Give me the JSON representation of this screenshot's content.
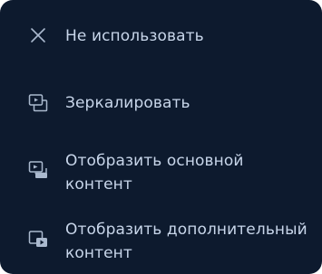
{
  "menu": {
    "items": [
      {
        "label": "Не использовать",
        "icon": "close-icon"
      },
      {
        "label": "Зеркалировать",
        "icon": "mirror-screen-icon"
      },
      {
        "label": "Отобразить основной контент",
        "icon": "main-content-icon"
      },
      {
        "label": "Отобразить дополнительный контент",
        "icon": "extra-content-icon"
      }
    ]
  },
  "colors": {
    "background": "#0d1a2e",
    "text": "#c8d6ea",
    "icon": "#aab9ce"
  }
}
